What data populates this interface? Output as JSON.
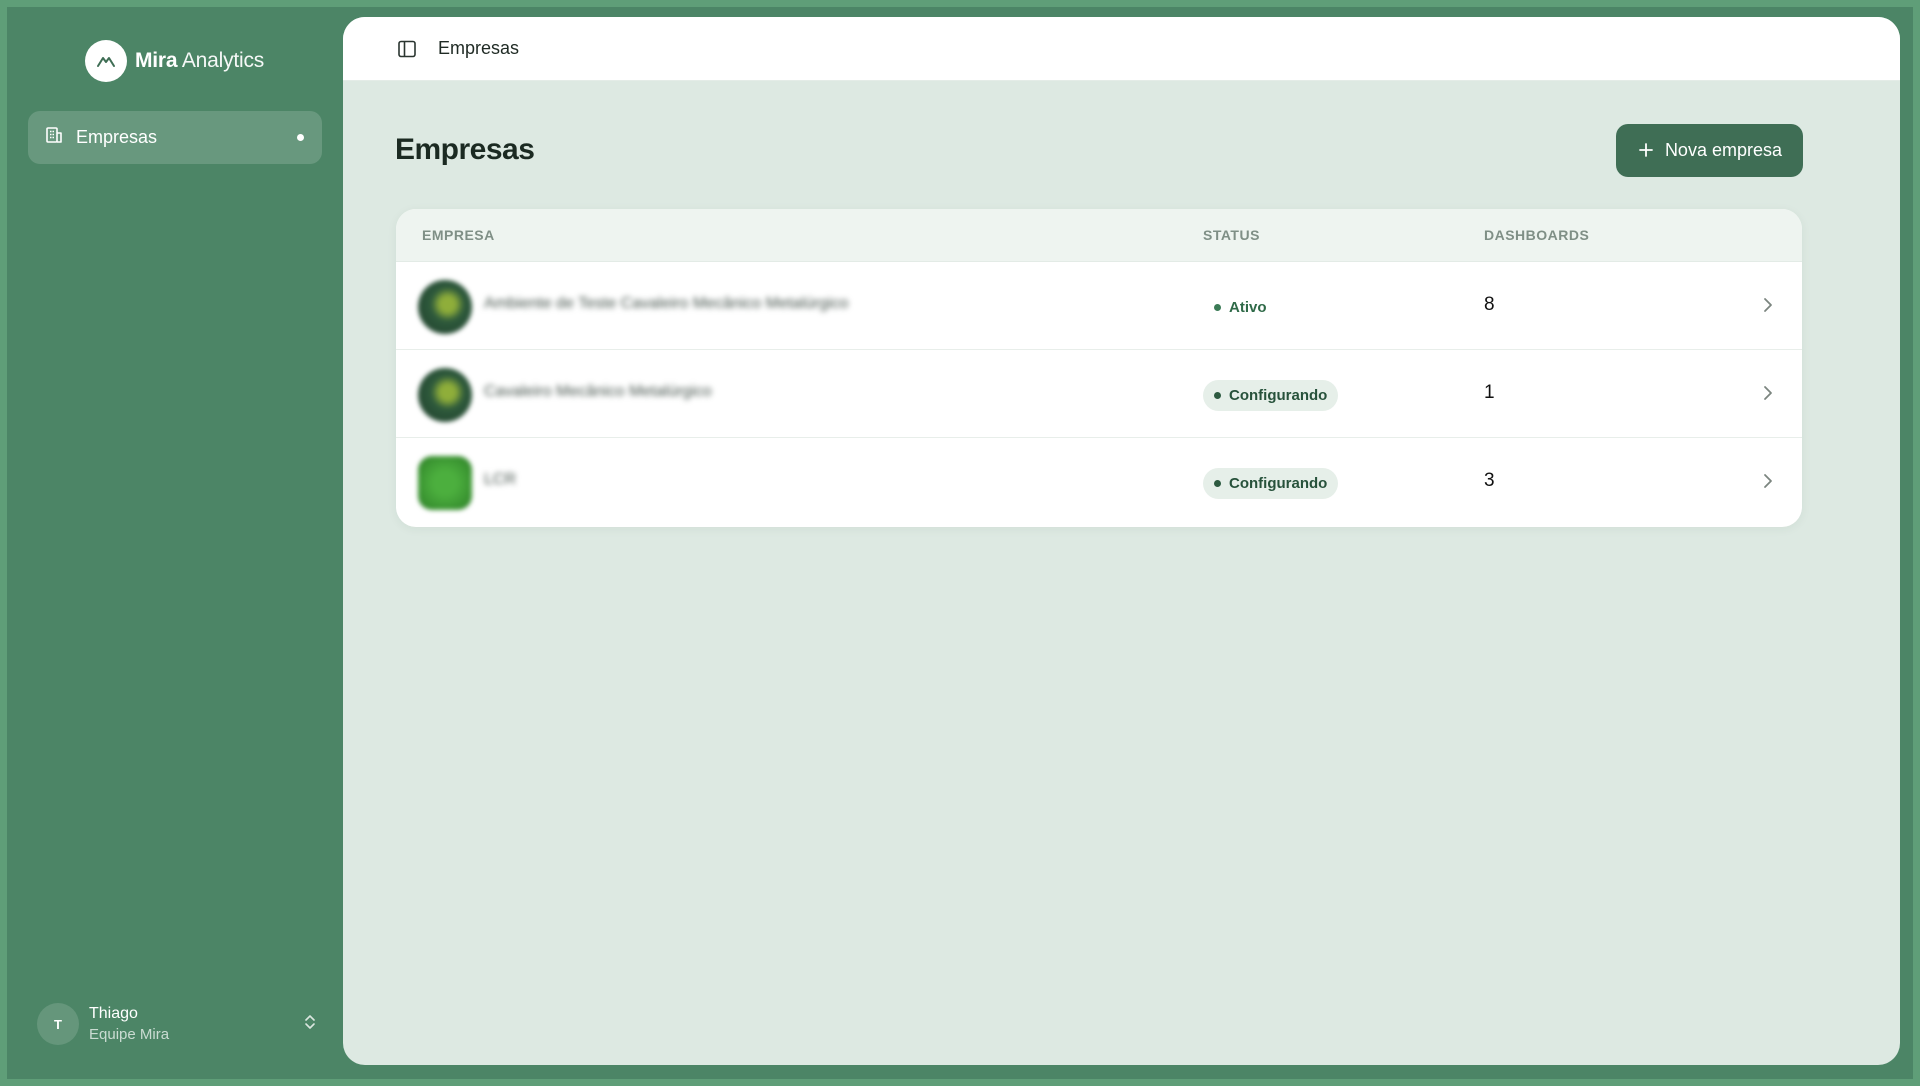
{
  "brand": {
    "name_bold": "Mira",
    "name_light": "Analytics"
  },
  "sidebar": {
    "items": [
      {
        "label": "Empresas",
        "icon": "building-icon",
        "active": true
      }
    ]
  },
  "user": {
    "initial": "T",
    "name": "Thiago",
    "team": "Equipe Mira"
  },
  "topbar": {
    "title": "Empresas"
  },
  "page": {
    "title": "Empresas",
    "new_button_label": "Nova empresa"
  },
  "table": {
    "headers": {
      "empresa": "EMPRESA",
      "status": "STATUS",
      "dashboards": "DASHBOARDS"
    },
    "rows": [
      {
        "name": "Ambiente de Teste Cavaleiro Mecânico Metalúrgico",
        "status": "Ativo",
        "dashboards": "8"
      },
      {
        "name": "Cavaleiro Mecânico Metalúrgico",
        "status": "Configurando",
        "dashboards": "1"
      },
      {
        "name": "LCR",
        "status": "Configurando",
        "dashboards": "3"
      }
    ]
  },
  "colors": {
    "sidebar_bg": "#4c8566",
    "accent": "#3f6e55",
    "main_bg": "#dde9e2",
    "status_active": "#3b7b56"
  }
}
